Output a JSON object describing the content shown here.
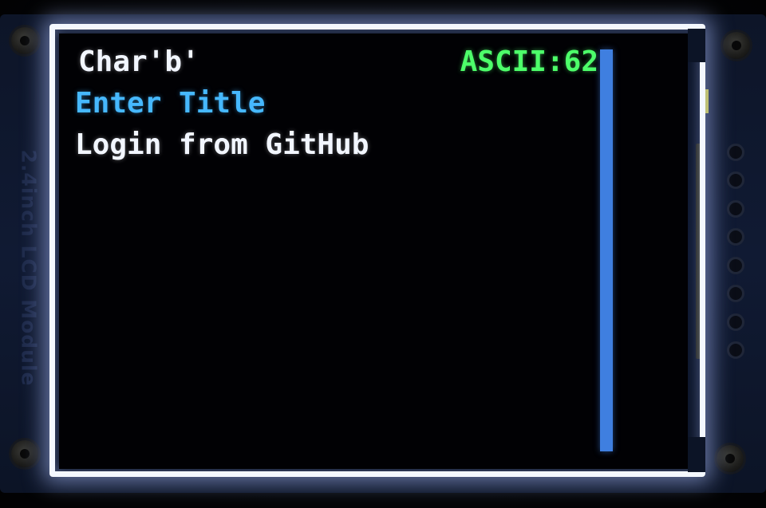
{
  "module": {
    "label": "2.4inch LCD Module"
  },
  "lcd": {
    "char_line": "Char'b'",
    "ascii_line": "ASCII:62",
    "title_line": "Enter Title",
    "login_line": "Login from GitHub"
  },
  "colors": {
    "text_white": "#f2f6ff",
    "text_green": "#4dff6a",
    "text_blue": "#46b8ff",
    "scrollbar": "#3f7fe0",
    "screen_bg": "#010104",
    "pcb": "#101a33"
  },
  "icons": {
    "mount_holes": [
      "mount-hole-icon",
      "mount-hole-icon",
      "mount-hole-icon",
      "mount-hole-icon"
    ],
    "header_pins": [
      "pin-icon",
      "pin-icon",
      "pin-icon",
      "pin-icon",
      "pin-icon",
      "pin-icon",
      "pin-icon",
      "pin-icon"
    ]
  }
}
